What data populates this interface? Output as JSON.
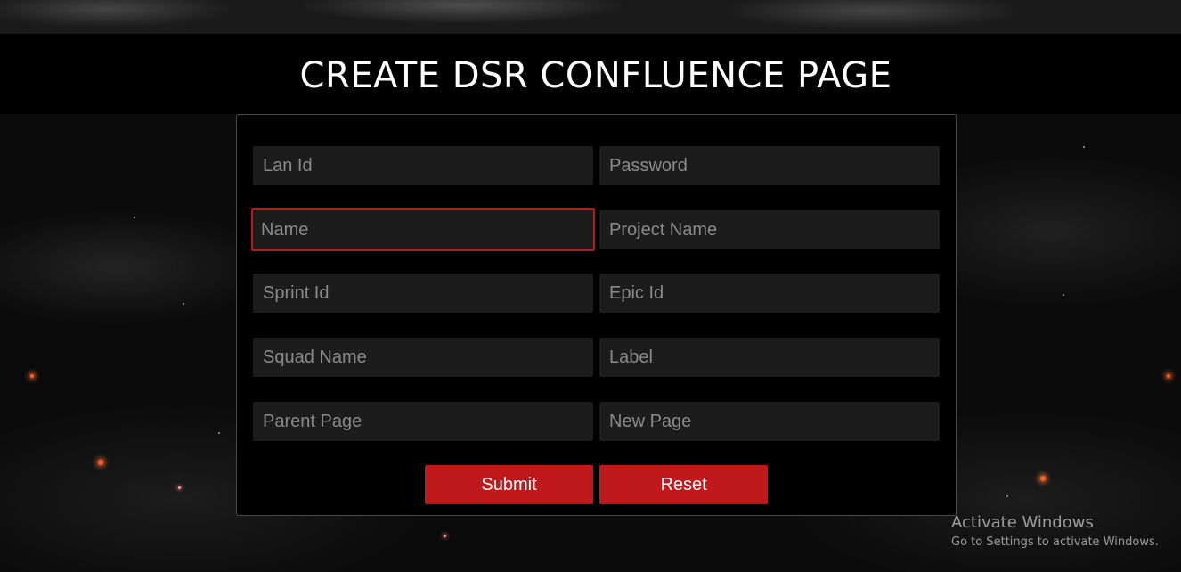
{
  "page": {
    "title": "CREATE DSR CONFLUENCE PAGE"
  },
  "form": {
    "fields": [
      {
        "placeholder": "Lan Id",
        "value": "",
        "focused": false
      },
      {
        "placeholder": "Password",
        "value": "",
        "focused": false
      },
      {
        "placeholder": "Name",
        "value": "",
        "focused": true
      },
      {
        "placeholder": "Project Name",
        "value": "",
        "focused": false
      },
      {
        "placeholder": "Sprint Id",
        "value": "",
        "focused": false
      },
      {
        "placeholder": "Epic Id",
        "value": "",
        "focused": false
      },
      {
        "placeholder": "Squad Name",
        "value": "",
        "focused": false
      },
      {
        "placeholder": "Label",
        "value": "",
        "focused": false
      },
      {
        "placeholder": "Parent Page",
        "value": "",
        "focused": false
      },
      {
        "placeholder": "New Page",
        "value": "",
        "focused": false
      }
    ],
    "submit_label": "Submit",
    "reset_label": "Reset"
  },
  "watermark": {
    "title": "Activate Windows",
    "subtitle": "Go to Settings to activate Windows."
  },
  "colors": {
    "accent": "#c0191c",
    "focus_border": "#b31d1d",
    "field_bg": "#1c1c1c",
    "card_border": "#4a4a4a"
  }
}
